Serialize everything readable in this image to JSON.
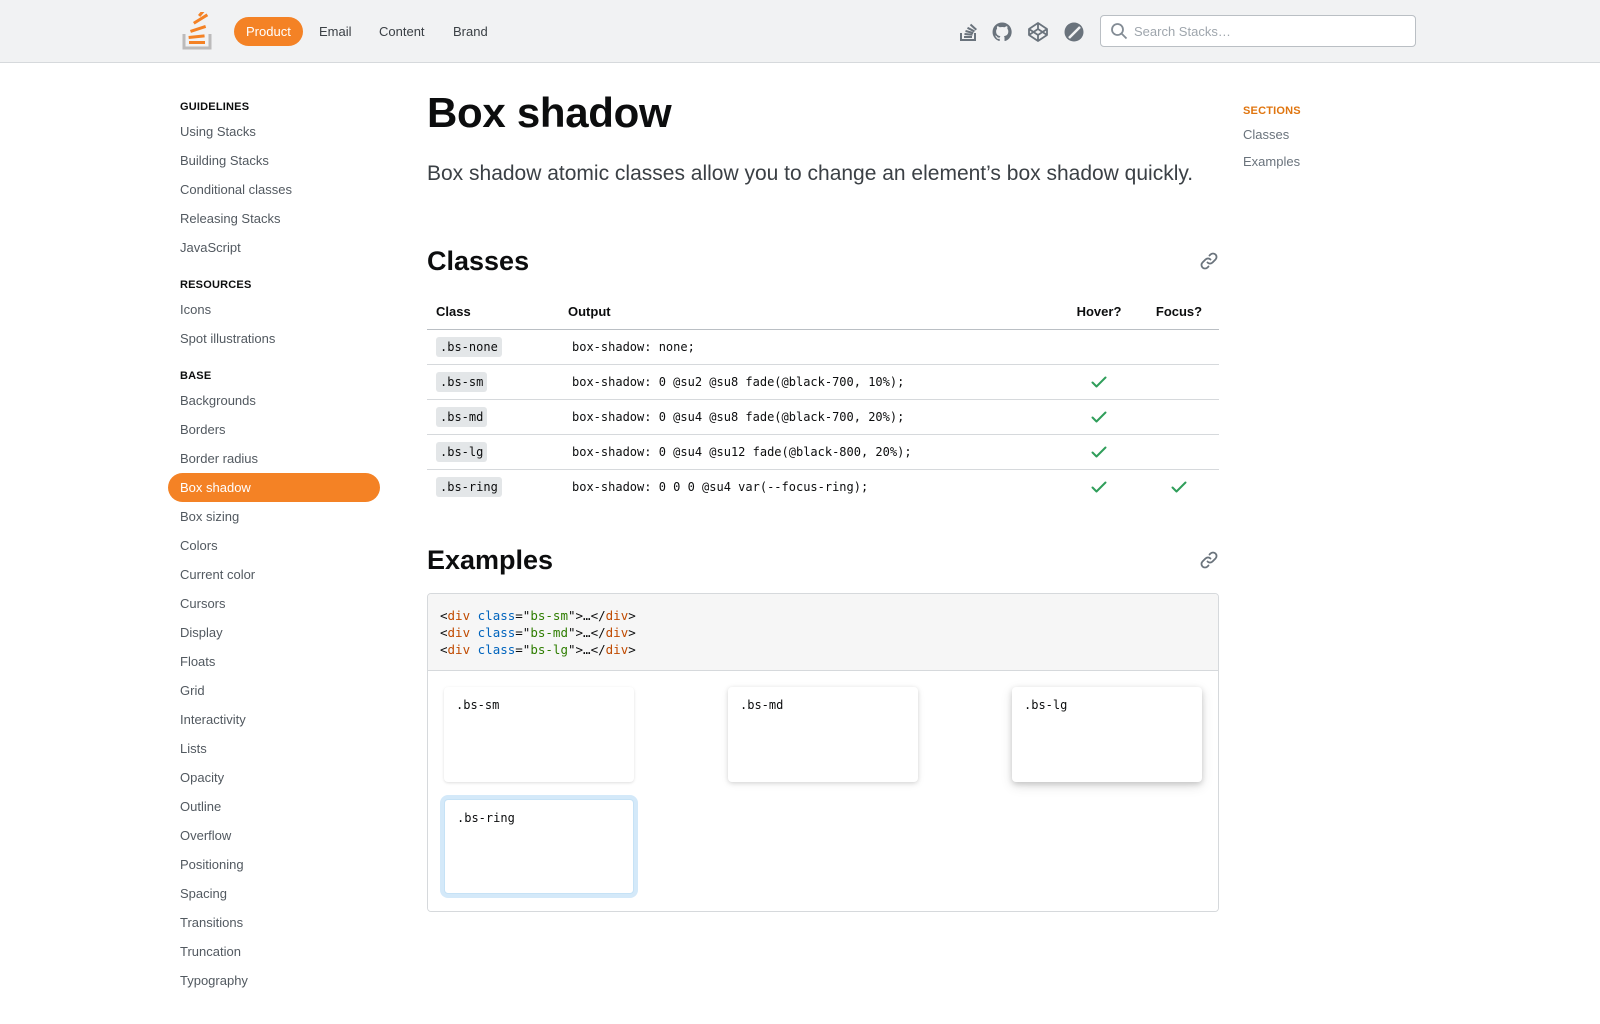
{
  "header": {
    "nav": [
      "Product",
      "Email",
      "Content",
      "Brand"
    ],
    "active_nav": "Product",
    "icons": [
      "stack-overflow-icon",
      "github-icon",
      "codepen-icon",
      "theme-toggle-icon"
    ],
    "search_placeholder": "Search Stacks…",
    "accent": "#f48225"
  },
  "sidebar": {
    "groups": [
      {
        "heading": "GUIDELINES",
        "items": [
          "Using Stacks",
          "Building Stacks",
          "Conditional classes",
          "Releasing Stacks",
          "JavaScript"
        ]
      },
      {
        "heading": "RESOURCES",
        "items": [
          "Icons",
          "Spot illustrations"
        ]
      },
      {
        "heading": "BASE",
        "items": [
          "Backgrounds",
          "Borders",
          "Border radius",
          "Box shadow",
          "Box sizing",
          "Colors",
          "Current color",
          "Cursors",
          "Display",
          "Floats",
          "Grid",
          "Interactivity",
          "Lists",
          "Opacity",
          "Outline",
          "Overflow",
          "Positioning",
          "Spacing",
          "Transitions",
          "Truncation",
          "Typography"
        ]
      }
    ],
    "active_item": "Box shadow"
  },
  "main": {
    "title": "Box shadow",
    "lead": "Box shadow atomic classes allow you to change an element’s box shadow quickly.",
    "classes_section": {
      "title": "Classes",
      "columns": [
        "Class",
        "Output",
        "Hover?",
        "Focus?"
      ],
      "rows": [
        {
          "cls": ".bs-none",
          "output": "box-shadow: none;",
          "hover": false,
          "focus": false
        },
        {
          "cls": ".bs-sm",
          "output": "box-shadow: 0 @su2 @su8 fade(@black-700, 10%);",
          "hover": true,
          "focus": false
        },
        {
          "cls": ".bs-md",
          "output": "box-shadow: 0 @su4 @su8 fade(@black-700, 20%);",
          "hover": true,
          "focus": false
        },
        {
          "cls": ".bs-lg",
          "output": "box-shadow: 0 @su4 @su12 fade(@black-800, 20%);",
          "hover": true,
          "focus": false
        },
        {
          "cls": ".bs-ring",
          "output": "box-shadow: 0 0 0 @su4 var(--focus-ring);",
          "hover": true,
          "focus": true
        }
      ]
    },
    "examples_section": {
      "title": "Examples",
      "code_lines": [
        {
          "tag": "div",
          "attr": "class",
          "value": "bs-sm",
          "inner": "…"
        },
        {
          "tag": "div",
          "attr": "class",
          "value": "bs-md",
          "inner": "…"
        },
        {
          "tag": "div",
          "attr": "class",
          "value": "bs-lg",
          "inner": "…"
        }
      ],
      "demos": [
        ".bs-sm",
        ".bs-md",
        ".bs-lg",
        ".bs-ring"
      ]
    }
  },
  "toc": {
    "heading": "SECTIONS",
    "items": [
      "Classes",
      "Examples"
    ]
  }
}
